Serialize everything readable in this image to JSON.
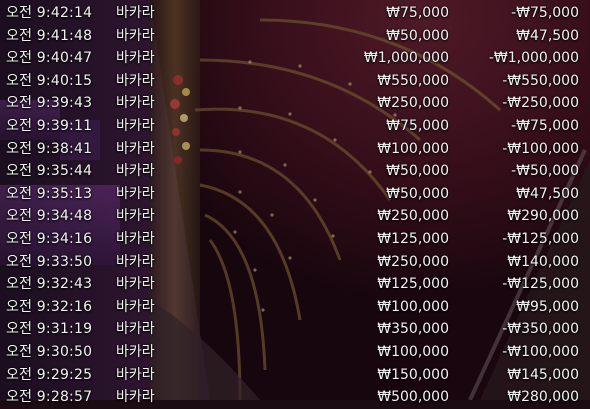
{
  "currency_symbol": "₩",
  "colors": {
    "text": "#f2f2f2",
    "background_dark": "#1a0c12",
    "background_purple": "#5a2a6e",
    "background_maroon": "#4a1522",
    "gold_accent": "#c79a3a"
  },
  "history": {
    "rows": [
      {
        "time": "오전 9:42:14",
        "game": "바카라",
        "bet": "₩75,000",
        "result": "-₩75,000"
      },
      {
        "time": "오전 9:41:48",
        "game": "바카라",
        "bet": "₩50,000",
        "result": "₩47,500"
      },
      {
        "time": "오전 9:40:47",
        "game": "바카라",
        "bet": "₩1,000,000",
        "result": "-₩1,000,000"
      },
      {
        "time": "오전 9:40:15",
        "game": "바카라",
        "bet": "₩550,000",
        "result": "-₩550,000"
      },
      {
        "time": "오전 9:39:43",
        "game": "바카라",
        "bet": "₩250,000",
        "result": "-₩250,000"
      },
      {
        "time": "오전 9:39:11",
        "game": "바카라",
        "bet": "₩75,000",
        "result": "-₩75,000"
      },
      {
        "time": "오전 9:38:41",
        "game": "바카라",
        "bet": "₩100,000",
        "result": "-₩100,000"
      },
      {
        "time": "오전 9:35:44",
        "game": "바카라",
        "bet": "₩50,000",
        "result": "-₩50,000"
      },
      {
        "time": "오전 9:35:13",
        "game": "바카라",
        "bet": "₩50,000",
        "result": "₩47,500"
      },
      {
        "time": "오전 9:34:48",
        "game": "바카라",
        "bet": "₩250,000",
        "result": "₩290,000"
      },
      {
        "time": "오전 9:34:16",
        "game": "바카라",
        "bet": "₩125,000",
        "result": "-₩125,000"
      },
      {
        "time": "오전 9:33:50",
        "game": "바카라",
        "bet": "₩250,000",
        "result": "₩140,000"
      },
      {
        "time": "오전 9:32:43",
        "game": "바카라",
        "bet": "₩125,000",
        "result": "-₩125,000"
      },
      {
        "time": "오전 9:32:16",
        "game": "바카라",
        "bet": "₩100,000",
        "result": "₩95,000"
      },
      {
        "time": "오전 9:31:19",
        "game": "바카라",
        "bet": "₩350,000",
        "result": "-₩350,000"
      },
      {
        "time": "오전 9:30:50",
        "game": "바카라",
        "bet": "₩100,000",
        "result": "-₩100,000"
      },
      {
        "time": "오전 9:29:25",
        "game": "바카라",
        "bet": "₩150,000",
        "result": "₩145,000"
      },
      {
        "time": "오전 9:28:57",
        "game": "바카라",
        "bet": "₩500,000",
        "result": "₩280,000"
      }
    ]
  }
}
